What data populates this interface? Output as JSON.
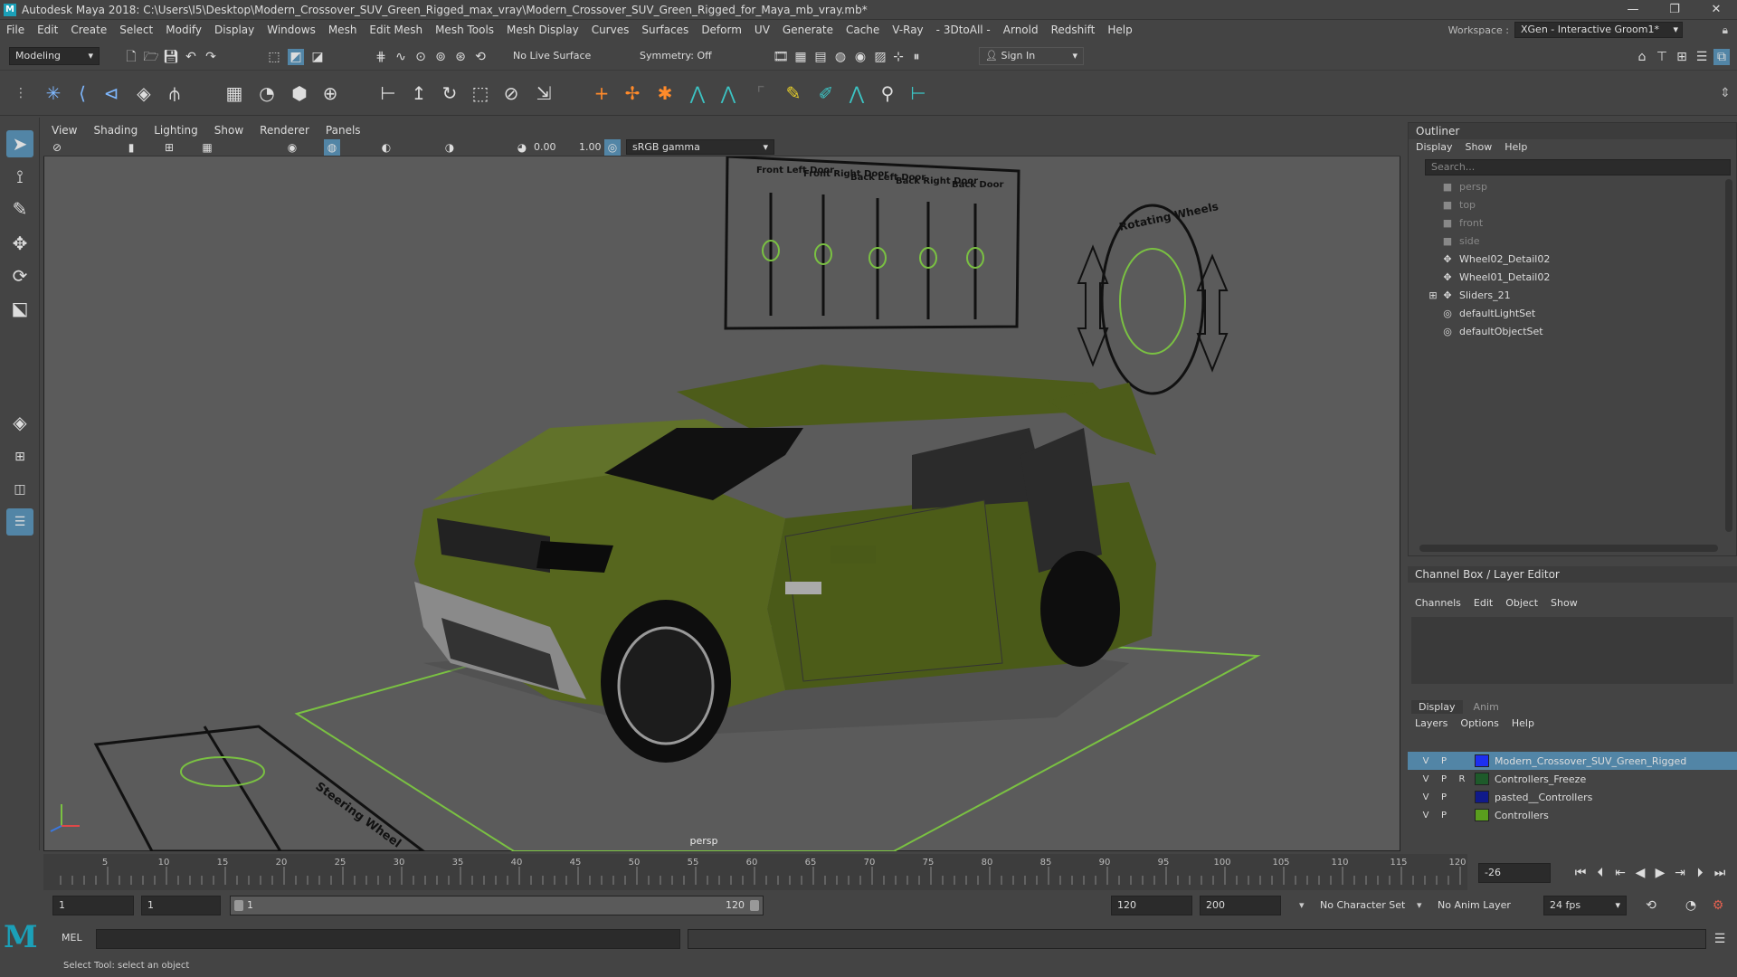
{
  "titlebar": {
    "text": "Autodesk Maya 2018: C:\\Users\\I5\\Desktop\\Modern_Crossover_SUV_Green_Rigged_max_vray\\Modern_Crossover_SUV_Green_Rigged_for_Maya_mb_vray.mb*",
    "minimize": "—",
    "maximize": "❐",
    "close": "✕"
  },
  "menubar": [
    "File",
    "Edit",
    "Create",
    "Select",
    "Modify",
    "Display",
    "Windows",
    "Mesh",
    "Edit Mesh",
    "Mesh Tools",
    "Mesh Display",
    "Curves",
    "Surfaces",
    "Deform",
    "UV",
    "Generate",
    "Cache",
    "V-Ray",
    "- 3DtoAll -",
    "Arnold",
    "Redshift",
    "Help"
  ],
  "workspace": {
    "label": "Workspace :",
    "value": "XGen - Interactive Groom1*"
  },
  "statusline": {
    "mode": "Modeling",
    "live_surface": "No Live Surface",
    "symmetry": "Symmetry: Off",
    "sign_in": "Sign In"
  },
  "viewport": {
    "menu": [
      "View",
      "Shading",
      "Lighting",
      "Show",
      "Renderer",
      "Panels"
    ],
    "exposure": "0.00",
    "gamma": "1.00",
    "colorspace": "sRGB gamma",
    "camera": "persp",
    "slider_labels": [
      "Front Left Door",
      "Front Right Door",
      "Back Left Door",
      "Back Right Door",
      "Back Door"
    ],
    "wheels_label": "Rotating Wheels",
    "steering_label": "Steering Wheel"
  },
  "outliner": {
    "title": "Outliner",
    "menu": [
      "Display",
      "Show",
      "Help"
    ],
    "search_placeholder": "Search...",
    "items": [
      {
        "label": "persp",
        "dim": true,
        "icon": "camera-icon"
      },
      {
        "label": "top",
        "dim": true,
        "icon": "camera-icon"
      },
      {
        "label": "front",
        "dim": true,
        "icon": "camera-icon"
      },
      {
        "label": "side",
        "dim": true,
        "icon": "camera-icon"
      },
      {
        "label": "Wheel02_Detail02",
        "dim": false,
        "icon": "transform-icon"
      },
      {
        "label": "Wheel01_Detail02",
        "dim": false,
        "icon": "transform-icon"
      },
      {
        "label": "Sliders_21",
        "dim": false,
        "icon": "transform-icon",
        "expand": "⊞"
      },
      {
        "label": "defaultLightSet",
        "dim": false,
        "icon": "set-icon"
      },
      {
        "label": "defaultObjectSet",
        "dim": false,
        "icon": "set-icon"
      }
    ]
  },
  "channelbox": {
    "title": "Channel Box / Layer Editor",
    "menu": [
      "Channels",
      "Edit",
      "Object",
      "Show"
    ]
  },
  "layers": {
    "tabs": [
      "Display",
      "Anim"
    ],
    "menu": [
      "Layers",
      "Options",
      "Help"
    ],
    "rows": [
      {
        "v": "V",
        "p": "P",
        "r": "",
        "name": "Modern_Crossover_SUV_Green_Rigged",
        "color": "#1d2ff0",
        "selected": true
      },
      {
        "v": "V",
        "p": "P",
        "r": "R",
        "name": "Controllers_Freeze",
        "color": "#1e5a2a",
        "selected": false
      },
      {
        "v": "V",
        "p": "P",
        "r": "",
        "name": "pasted__Controllers",
        "color": "#101a8a",
        "selected": false
      },
      {
        "v": "V",
        "p": "P",
        "r": "",
        "name": "Controllers",
        "color": "#5a9e1e",
        "selected": false
      }
    ]
  },
  "timeline": {
    "ticks": [
      "5",
      "10",
      "15",
      "20",
      "25",
      "30",
      "35",
      "40",
      "45",
      "50",
      "55",
      "60",
      "65",
      "70",
      "75",
      "80",
      "85",
      "90",
      "95",
      "100",
      "105",
      "110",
      "115",
      "120"
    ],
    "current_frame": "-26"
  },
  "range": {
    "start": "1",
    "playback_start": "1",
    "slider_start": "1",
    "slider_end": "120",
    "playback_end": "120",
    "end": "200",
    "character_set": "No Character Set",
    "anim_layer": "No Anim Layer",
    "fps": "24 fps"
  },
  "cmdline": {
    "label": "MEL"
  },
  "helpline": {
    "text": "Select Tool: select an object"
  },
  "colors": {
    "car": "#4f5f1c",
    "control": "#7ac142",
    "selected_layer": "#5285a6"
  }
}
